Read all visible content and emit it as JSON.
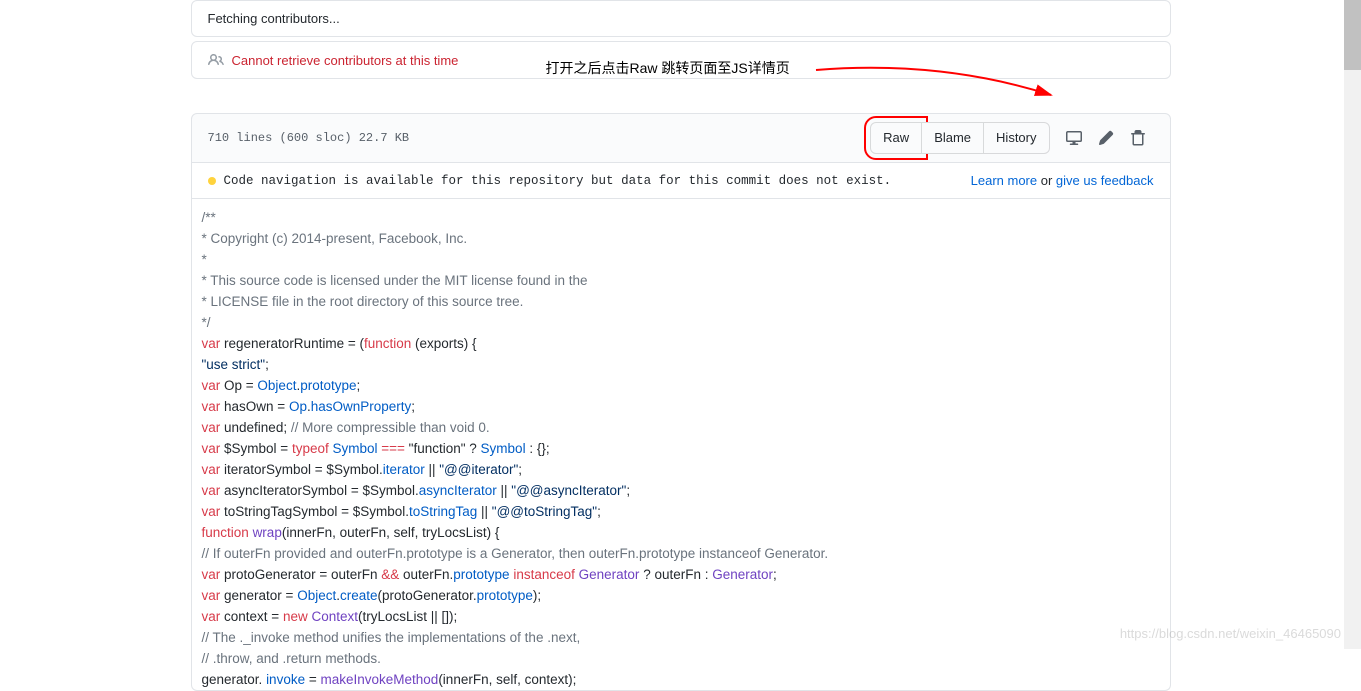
{
  "alerts": {
    "fetching": "Fetching contributors...",
    "error": "Cannot retrieve contributors at this time"
  },
  "annotation": "打开之后点击Raw 跳转页面至JS详情页",
  "fileHeader": {
    "info": "710 lines (600 sloc)  22.7 KB",
    "buttons": {
      "raw": "Raw",
      "blame": "Blame",
      "history": "History"
    }
  },
  "codeNav": {
    "msg": "Code navigation is available for this repository but data for this commit does not exist.",
    "learnMore": "Learn more",
    "or": " or ",
    "feedback": "give us feedback"
  },
  "code": {
    "l1": "/**",
    "l2": "* Copyright (c) 2014-present, Facebook, Inc.",
    "l3": "*",
    "l4": "* This source code is licensed under the MIT license found in the",
    "l5": "* LICENSE file in the root directory of this source tree.",
    "l6": "*/",
    "l7a": "var",
    "l7b": " regeneratorRuntime = (",
    "l7c": "function",
    "l7d": " (exports) {",
    "l8": "\"use strict\"",
    "l8b": ";",
    "l9a": "var",
    "l9b": " Op = ",
    "l9c": "Object",
    "l9d": ".",
    "l9e": "prototype",
    "l9f": ";",
    "l10a": "var",
    "l10b": " hasOwn = ",
    "l10c": "Op",
    "l10d": ".",
    "l10e": "hasOwnProperty",
    "l10f": ";",
    "l11a": "var",
    "l11b": " undefined; ",
    "l11c": "// More compressible than void 0.",
    "l12a": "var",
    "l12b": " $Symbol = ",
    "l12c": "typeof",
    "l12d": " Symbol ",
    "l12e": "===",
    "l12f": " \"function\" ? ",
    "l12g": "Symbol",
    "l12h": " : {};",
    "l13a": "var",
    "l13b": " iteratorSymbol = $Symbol.",
    "l13c": "iterator",
    "l13d": " || ",
    "l13e": "\"@@iterator\"",
    "l13f": ";",
    "l14a": "var",
    "l14b": " asyncIteratorSymbol = $Symbol.",
    "l14c": "asyncIterator",
    "l14d": " || ",
    "l14e": "\"@@asyncIterator\"",
    "l14f": ";",
    "l15a": "var",
    "l15b": " toStringTagSymbol = $Symbol.",
    "l15c": "toStringTag",
    "l15d": " || ",
    "l15e": "\"@@toStringTag\"",
    "l15f": ";",
    "l16a": "function",
    "l16b": " ",
    "l16c": "wrap",
    "l16d": "(innerFn, outerFn, self, tryLocsList) {",
    "l17": "// If outerFn provided and outerFn.prototype is a Generator, then outerFn.prototype instanceof Generator.",
    "l18a": "var",
    "l18b": " protoGenerator = outerFn ",
    "l18c": "&&",
    "l18d": " outerFn.",
    "l18e": "prototype",
    "l18f": " ",
    "l18g": "instanceof",
    "l18h": " Generator",
    "l18i": " ? outerFn : ",
    "l18j": "Generator",
    "l18k": ";",
    "l19a": "var",
    "l19b": " generator = ",
    "l19c": "Object",
    "l19d": ".",
    "l19e": "create",
    "l19f": "(protoGenerator.",
    "l19g": "prototype",
    "l19h": ");",
    "l20a": "var",
    "l20b": " context = ",
    "l20c": "new",
    "l20d": " ",
    "l20e": "Context",
    "l20f": "(tryLocsList || []);",
    "l21": "// The ._invoke method unifies the implementations of the .next,",
    "l22": "// .throw, and .return methods.",
    "l23a": "generator.",
    "l23b": " ",
    "l23c": "invoke",
    "l23d": " = ",
    "l23e": "makeInvokeMethod",
    "l23f": "(innerFn, self, context);"
  },
  "watermark": "https://blog.csdn.net/weixin_46465090"
}
